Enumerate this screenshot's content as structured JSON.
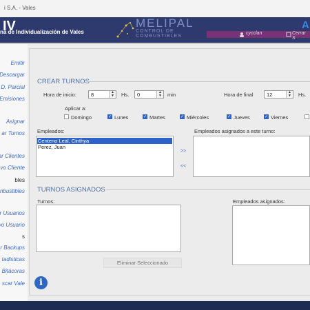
{
  "window": {
    "title": "i S.A. - Vales"
  },
  "header": {
    "brand": "IV",
    "subtitle": "na de Individualización de Vales",
    "logo_main": "MELIPAL",
    "logo_sub": "CONTROL DE COMBUSTIBLES",
    "user": "cycclan",
    "logout": "Cerrar S",
    "brand_right": "A"
  },
  "sidebar": {
    "items": [
      "Emitir",
      "Descargar",
      "D. Parcial",
      "Emisiones",
      "Asignar",
      "ar Turnos",
      "ar Clientes",
      "vo Cliente",
      "bles",
      "nbustibles",
      "r Usuarios",
      "vo Usuario",
      "s",
      "r Backups",
      "tadisticas",
      "Bitácoras",
      "scar Vale"
    ]
  },
  "crear_turnos": {
    "title": "CREAR TURNOS",
    "hora_inicio_label": "Hora de inicio:",
    "hora_inicio": "8",
    "hs_label": "Hs.",
    "min_value": "0",
    "min_label": "min",
    "hora_final_label": "Hora de final",
    "hora_final": "12",
    "hs_label2": "Hs.",
    "aplicar_label": "Aplicar a:",
    "days": [
      {
        "label": "Domingo",
        "checked": false
      },
      {
        "label": "Lunes",
        "checked": true
      },
      {
        "label": "Martes",
        "checked": true
      },
      {
        "label": "Miércoles",
        "checked": true
      },
      {
        "label": "Jueves",
        "checked": true
      },
      {
        "label": "Viernes",
        "checked": true
      }
    ],
    "empleados_label": "Empleados:",
    "empleados": [
      "Centeno Leal, Cinthya",
      "Perez, Juan"
    ],
    "asignados_label": "Empleados asignados a este turno:",
    "add_btn": ">>",
    "remove_btn": "<<"
  },
  "turnos_asignados": {
    "title": "TURNOS ASIGNADOS",
    "turnos_label": "Turnos:",
    "empleados_asignados_label": "Empleados asignados:",
    "delete_btn": "Eliminar Seleccionado"
  },
  "info_icon_glyph": "i"
}
